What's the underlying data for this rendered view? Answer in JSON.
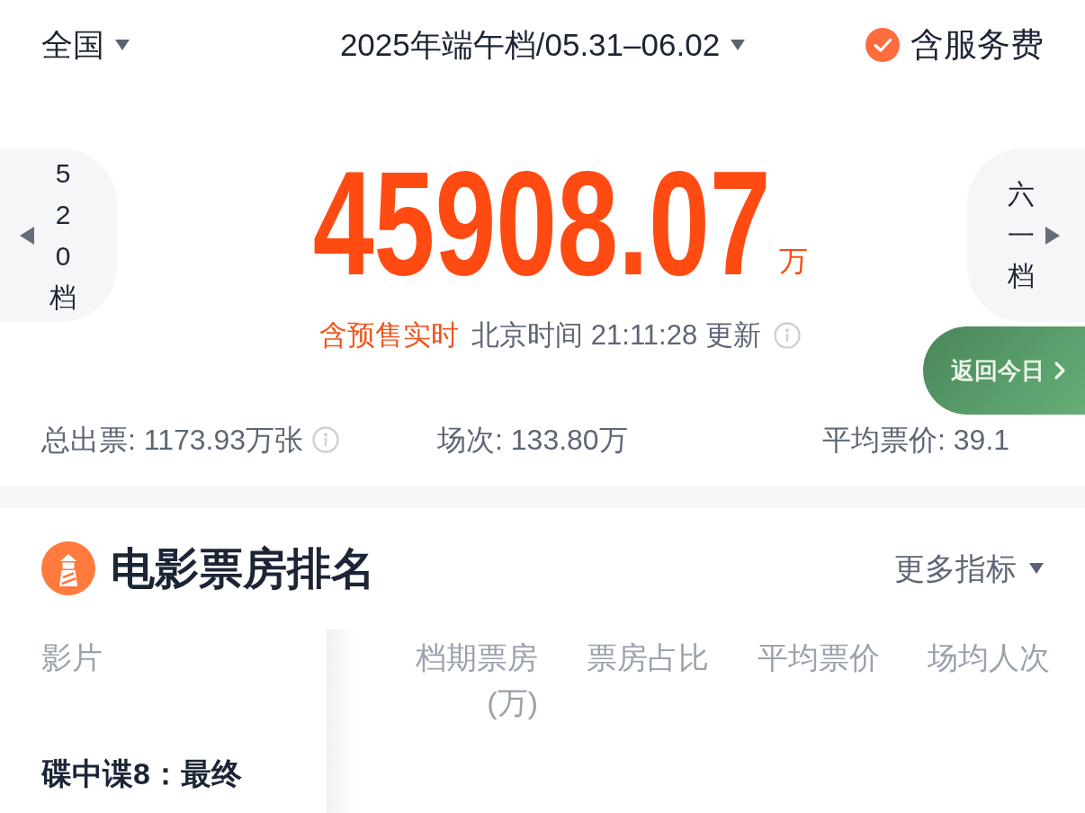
{
  "filter_bar": {
    "region": "全国",
    "period": "2025年端午档/05.31–06.02",
    "service_fee": {
      "label": "含服务费",
      "checked": true
    }
  },
  "box_office": {
    "prev_period": "520档",
    "next_period": "六一档",
    "total": "45908.07",
    "unit": "万",
    "realtime_label": "含预售实时",
    "update_text": "北京时间 21:11:28 更新",
    "return_button": "返回今日"
  },
  "stats": [
    {
      "text": "总出票: 1173.93万张",
      "info": true
    },
    {
      "text": "场次: 133.80万",
      "info": false
    },
    {
      "text": "平均票价: 39.1",
      "info": false
    }
  ],
  "ranking": {
    "title": "电影票房排名",
    "more_metrics": "更多指标",
    "table": {
      "columns": [
        "影片",
        "档期票房(万)",
        "票房占比",
        "平均票价",
        "场均人次"
      ],
      "rows": [
        {
          "film": "碟中谍8：最终"
        }
      ]
    }
  }
}
